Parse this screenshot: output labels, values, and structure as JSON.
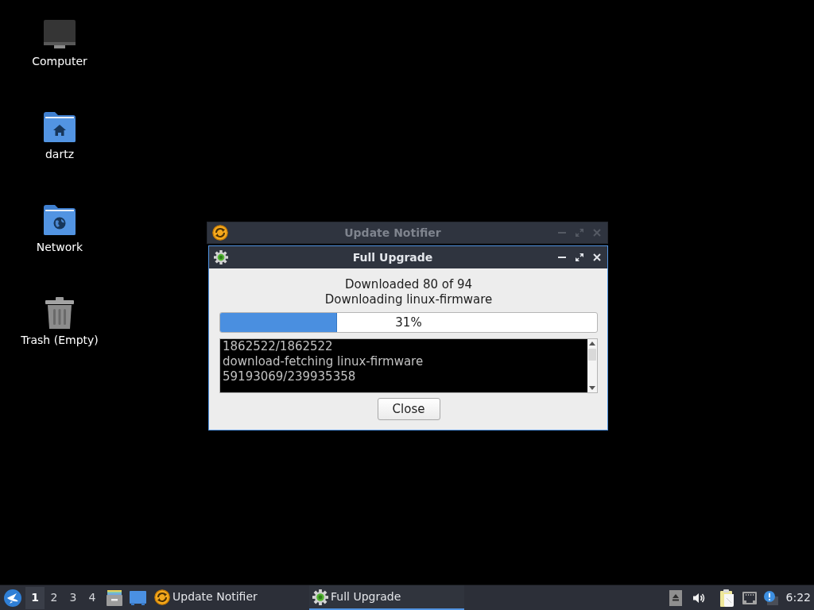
{
  "desktop": {
    "icons": [
      {
        "kind": "computer",
        "label": "Computer"
      },
      {
        "kind": "home",
        "label": "dartz"
      },
      {
        "kind": "network",
        "label": "Network"
      },
      {
        "kind": "trash",
        "label": "Trash (Empty)"
      }
    ]
  },
  "windows": [
    {
      "kind": "notifier",
      "title": "Update Notifier",
      "active": false
    },
    {
      "kind": "upgrade",
      "title": "Full Upgrade",
      "active": true,
      "status_lines": [
        "Downloaded 80 of 94",
        "Downloading linux-firmware"
      ],
      "progress": {
        "level": 0.31,
        "reading": "31%"
      },
      "log_lines": [
        "1862522/1862522",
        "download-fetching linux-firmware",
        "59193069/239935358"
      ],
      "button": "Close"
    }
  ],
  "taskbar": {
    "workspaces": [
      {
        "label": "1",
        "selected": true
      },
      {
        "label": "2",
        "selected": false
      },
      {
        "label": "3",
        "selected": false
      },
      {
        "label": "4",
        "selected": false
      }
    ],
    "tasks": [
      {
        "kind": "notifier",
        "label": "Update Notifier",
        "selected": false
      },
      {
        "kind": "upgrade",
        "label": "Full Upgrade",
        "selected": true
      }
    ],
    "clock": "6:22"
  }
}
